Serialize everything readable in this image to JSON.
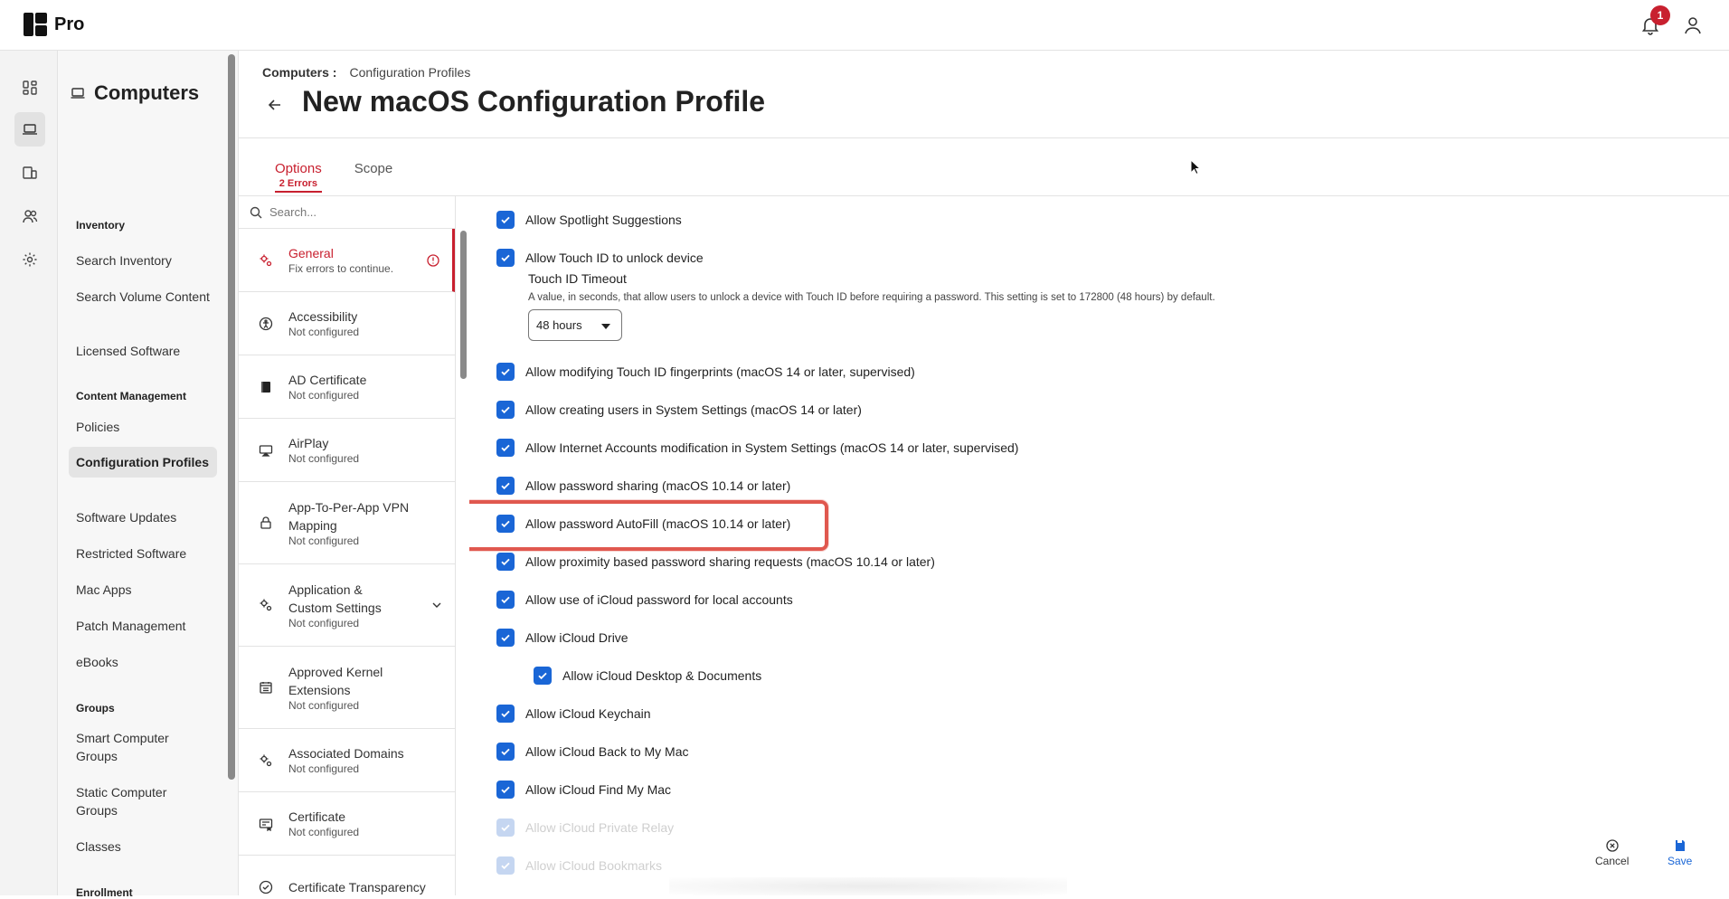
{
  "topbar": {
    "brand": "Pro",
    "notifications_count": "1"
  },
  "rail": {
    "icons": [
      "dashboard-icon",
      "computers-icon",
      "devices-icon",
      "users-icon",
      "settings-icon"
    ],
    "active_index": 1
  },
  "sidebar": {
    "title": "Computers",
    "sections": [
      {
        "heading": "Inventory",
        "items": [
          "Search Inventory",
          "Search Volume Content",
          "Licensed Software"
        ]
      },
      {
        "heading": "Content Management",
        "items": [
          "Policies",
          "Configuration Profiles",
          "Software Updates",
          "Restricted Software",
          "Mac Apps",
          "Patch Management",
          "eBooks"
        ]
      },
      {
        "heading": "Groups",
        "items": [
          "Smart Computer Groups",
          "Static Computer Groups",
          "Classes"
        ]
      },
      {
        "heading": "Enrollment",
        "items": []
      }
    ],
    "active_item": "Configuration Profiles"
  },
  "breadcrumb": {
    "parent": "Computers",
    "separator": ":",
    "current": "Configuration Profiles"
  },
  "page": {
    "title": "New macOS Configuration Profile"
  },
  "tabs": [
    {
      "label": "Options",
      "sub": "2 Errors",
      "active": true
    },
    {
      "label": "Scope",
      "sub": "",
      "active": false
    }
  ],
  "payload_search": {
    "placeholder": "Search..."
  },
  "payloads": [
    {
      "name": "General",
      "status": "Fix errors to continue.",
      "error": true
    },
    {
      "name": "Accessibility",
      "status": "Not configured"
    },
    {
      "name": "AD Certificate",
      "status": "Not configured"
    },
    {
      "name": "AirPlay",
      "status": "Not configured"
    },
    {
      "name": "App-To-Per-App VPN Mapping",
      "status": "Not configured"
    },
    {
      "name": "Application & Custom Settings",
      "status": "Not configured",
      "expandable": true
    },
    {
      "name": "Approved Kernel Extensions",
      "status": "Not configured"
    },
    {
      "name": "Associated Domains",
      "status": "Not configured"
    },
    {
      "name": "Certificate",
      "status": "Not configured"
    },
    {
      "name": "Certificate Transparency",
      "status": ""
    }
  ],
  "options": {
    "items": [
      {
        "label": "Allow Spotlight Suggestions",
        "checked": true
      },
      {
        "label": "Allow Touch ID to unlock device",
        "checked": true
      },
      {
        "label": "Allow modifying Touch ID fingerprints (macOS 14 or later, supervised)",
        "checked": true
      },
      {
        "label": "Allow creating users in System Settings (macOS 14 or later)",
        "checked": true
      },
      {
        "label": "Allow Internet Accounts modification in System Settings (macOS 14 or later, supervised)",
        "checked": true
      },
      {
        "label": "Allow password sharing (macOS 10.14 or later)",
        "checked": true
      },
      {
        "label": "Allow password AutoFill (macOS 10.14 or later)",
        "checked": true,
        "highlighted": true
      },
      {
        "label": "Allow proximity based password sharing requests (macOS 10.14 or later)",
        "checked": true
      },
      {
        "label": "Allow use of iCloud password for local accounts",
        "checked": true
      },
      {
        "label": "Allow iCloud Drive",
        "checked": true
      },
      {
        "label": "Allow iCloud Desktop & Documents",
        "checked": true,
        "indented": true
      },
      {
        "label": "Allow iCloud Keychain",
        "checked": true
      },
      {
        "label": "Allow iCloud Back to My Mac",
        "checked": true
      },
      {
        "label": "Allow iCloud Find My Mac",
        "checked": true
      },
      {
        "label": "Allow iCloud Private Relay",
        "checked": true,
        "faded": true
      },
      {
        "label": "Allow iCloud Bookmarks",
        "checked": true,
        "faded": true
      }
    ],
    "touch_id_timeout": {
      "title": "Touch ID Timeout",
      "description": "A value, in seconds, that allow users to unlock a device with Touch ID before requiring a password. This setting is set to 172800 (48 hours) by default.",
      "value": "48 hours"
    }
  },
  "footer": {
    "cancel_label": "Cancel",
    "save_label": "Save"
  },
  "colors": {
    "accent_blue": "#1a66d6",
    "error_red": "#c8202f",
    "highlight": "#e0584f"
  }
}
